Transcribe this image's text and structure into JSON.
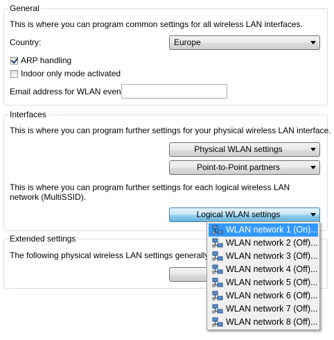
{
  "general": {
    "legend": "General",
    "description": "This is where you can program common settings for all wireless LAN interfaces.",
    "country_label": "Country:",
    "country_value": "Europe",
    "arp_label": "ARP handling",
    "arp_checked": true,
    "indoor_label": "Indoor only mode activated",
    "indoor_checked": false,
    "email_label": "Email address for WLAN events:",
    "email_value": ""
  },
  "interfaces": {
    "legend": "Interfaces",
    "physical_description": "This is where you can program further settings for your physical wireless LAN interface.",
    "physical_button": "Physical WLAN settings",
    "p2p_button": "Point-to-Point partners",
    "logical_description": "This is where you can program further settings for each logical wireless LAN network (MultiSSID).",
    "logical_button": "Logical WLAN settings"
  },
  "extended": {
    "legend": "Extended settings",
    "description": "The following physical wireless LAN settings generally need n"
  },
  "dropdown_menu": {
    "items": [
      {
        "label": "WLAN network 1 (On)...",
        "icon": "wlan-network-icon"
      },
      {
        "label": "WLAN network 2 (Off)...",
        "icon": "wlan-network-icon"
      },
      {
        "label": "WLAN network 3 (Off)...",
        "icon": "wlan-network-icon"
      },
      {
        "label": "WLAN network 4 (Off)...",
        "icon": "wlan-network-icon"
      },
      {
        "label": "WLAN network 5 (Off)...",
        "icon": "wlan-network-icon"
      },
      {
        "label": "WLAN network 6 (Off)...",
        "icon": "wlan-network-icon"
      },
      {
        "label": "WLAN network 7 (Off)...",
        "icon": "wlan-network-icon"
      },
      {
        "label": "WLAN network 8 (Off)...",
        "icon": "wlan-network-icon"
      }
    ],
    "selected_index": 0
  },
  "colors": {
    "menu_highlight": "#3399ff",
    "group_border": "#d5dfe5",
    "pressed_button": "#98d1ef"
  }
}
